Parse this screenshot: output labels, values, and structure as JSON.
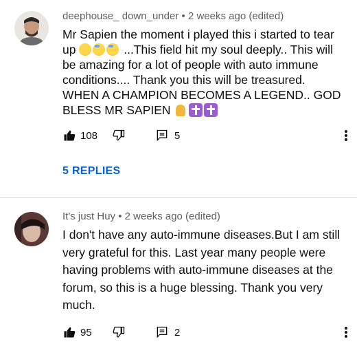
{
  "comments": [
    {
      "author": "deephouse_ down_under",
      "age": "2 weeks ago (edited)",
      "text_lines": [
        "Mr Sapien the moment i played this i started to tear",
        "...This field hit my soul deeply.. This will",
        "be amazing for a lot of people with auto immune",
        "conditions.... Thank you this will be treasured.",
        "WHEN A CHAMPION BECOMES A LEGEND.. GOD",
        "BLESS MR SAPIEN"
      ],
      "line2_prefix": "up",
      "likes": "108",
      "replies_count": "5",
      "replies_link": "5 REPLIES"
    },
    {
      "author": "It's just Huy",
      "age": "2 weeks ago (edited)",
      "text_lines": [
        "I don't have any auto-immune diseases.But I am still",
        "very grateful for this. Last year many people were",
        "having problems with auto-immune diseases at the",
        "forum, so this is a huge blessing. Thank you very",
        "much."
      ],
      "likes": "95",
      "replies_count": "2"
    }
  ],
  "separator": "•",
  "icons": {
    "like": "thumbs-up-icon",
    "dislike": "thumbs-down-icon",
    "reply": "comment-reply-icon",
    "more": "more-vert-icon"
  },
  "colors": {
    "link_blue": "#065fd4",
    "meta_gray": "#606060",
    "divider": "#d9d9d9"
  }
}
